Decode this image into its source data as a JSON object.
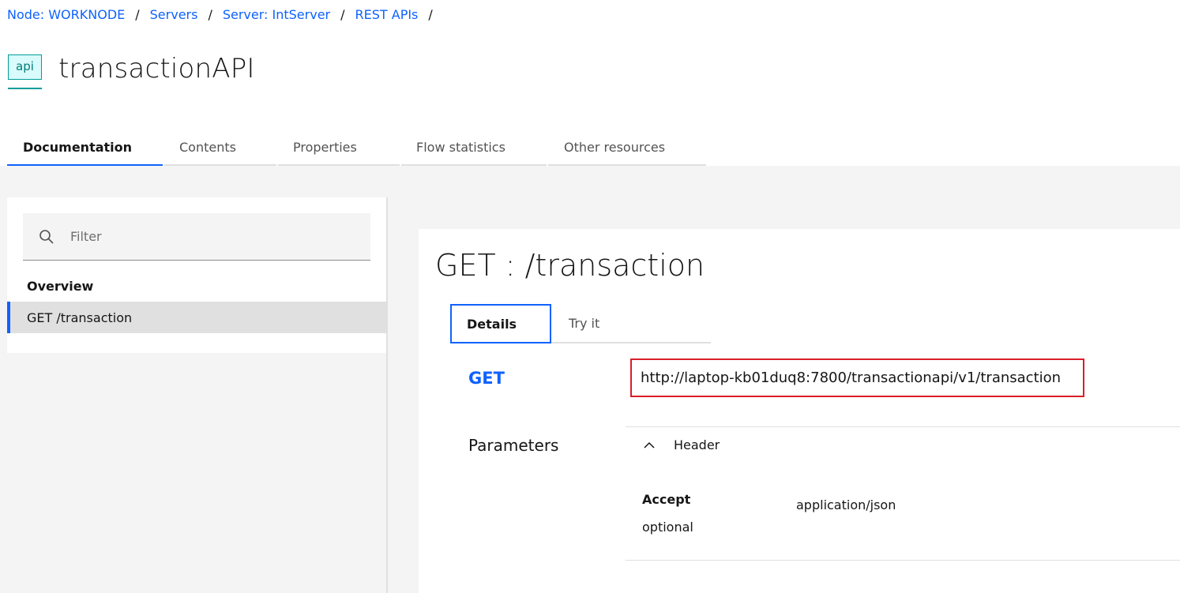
{
  "breadcrumb": {
    "items": [
      "Node: WORKNODE",
      "Servers",
      "Server: IntServer",
      "REST APIs"
    ],
    "separator": "/"
  },
  "header": {
    "icon_text": "api",
    "title": "transactionAPI"
  },
  "tabs": [
    {
      "label": "Documentation",
      "active": true
    },
    {
      "label": "Contents",
      "active": false
    },
    {
      "label": "Properties",
      "active": false
    },
    {
      "label": "Flow statistics",
      "active": false
    },
    {
      "label": "Other resources",
      "active": false
    }
  ],
  "sidebar": {
    "filter_placeholder": "Filter",
    "overview_label": "Overview",
    "items": [
      {
        "label": "GET /transaction",
        "selected": true
      }
    ]
  },
  "operation": {
    "title": "GET : /transaction",
    "tabs": [
      {
        "label": "Details",
        "active": true
      },
      {
        "label": "Try it",
        "active": false
      }
    ],
    "method": "GET",
    "url": "http://laptop-kb01duq8:7800/transactionapi/v1/transaction",
    "parameters_label": "Parameters",
    "header_section_label": "Header",
    "params": [
      {
        "name": "Accept",
        "required": "optional",
        "value": "application/json"
      }
    ]
  },
  "colors": {
    "accent": "#0f62fe",
    "highlight_border": "#da1e28",
    "api_icon": "#009d9a"
  }
}
